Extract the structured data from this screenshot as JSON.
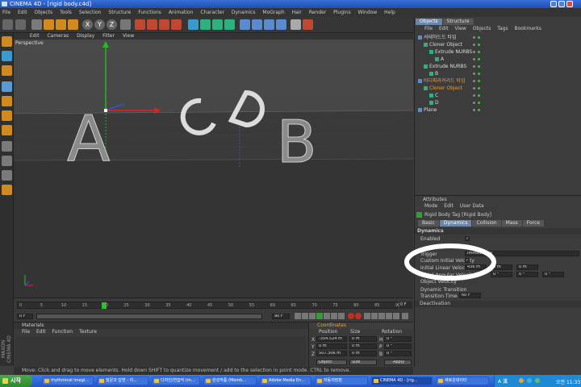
{
  "window": {
    "title": "CINEMA 4D - [rigid body.c4d]"
  },
  "menu": [
    "File",
    "Edit",
    "Objects",
    "Tools",
    "Selection",
    "Structure",
    "Functions",
    "Animation",
    "Character",
    "Dynamics",
    "MoGraph",
    "Hair",
    "Render",
    "Plugins",
    "Window",
    "Help"
  ],
  "toolbar": {
    "axis_labels": [
      "X",
      "Y",
      "Z"
    ]
  },
  "viewport": {
    "menu": [
      "Edit",
      "Cameras",
      "Display",
      "Filter",
      "View"
    ],
    "label": "Perspective",
    "scene_letters": [
      "A",
      "B"
    ]
  },
  "timeline": {
    "ticks": [
      "0",
      "5",
      "10",
      "15",
      "20",
      "25",
      "30",
      "35",
      "40",
      "45",
      "50",
      "55",
      "60",
      "65",
      "70",
      "75",
      "80",
      "85",
      "90"
    ],
    "current_frame": "0 F",
    "end_frame": "90 F",
    "end_field": "0 F",
    "start_field": "0 F"
  },
  "materials": {
    "title": "Materials",
    "menu": [
      "File",
      "Edit",
      "Function",
      "Texture"
    ]
  },
  "coordinates": {
    "title": "Coordinates",
    "headers": [
      "Position",
      "Size",
      "Rotation"
    ],
    "rows": [
      {
        "axis": "X",
        "pos": "-354.524 m",
        "size": "0 m",
        "rot_label": "H",
        "rot": "0 °"
      },
      {
        "axis": "Y",
        "pos": "0 m",
        "size": "0 m",
        "rot_label": "P",
        "rot": "0 °"
      },
      {
        "axis": "Z",
        "pos": "507.306 m",
        "size": "0 m",
        "rot_label": "B",
        "rot": "0 °"
      }
    ],
    "mode": "Object",
    "size_mode": "Size",
    "apply": "Apply"
  },
  "objects": {
    "tabs": [
      "Objects",
      "Structure"
    ],
    "menu": [
      "File",
      "Edit",
      "View",
      "Objects",
      "Tags",
      "Bookmarks"
    ],
    "rows": [
      {
        "label": "서테하드드 타입",
        "indent": 0,
        "color": "#dddddd"
      },
      {
        "label": "Cloner Object",
        "indent": 1,
        "color": "#dddddd"
      },
      {
        "label": "Extrude NURBS",
        "indent": 2,
        "color": "#dddddd"
      },
      {
        "label": "A",
        "indent": 3,
        "color": "#dddddd"
      },
      {
        "label": "Extrude NURBS",
        "indent": 1,
        "color": "#dddddd"
      },
      {
        "label": "B",
        "indent": 2,
        "color": "#dddddd"
      },
      {
        "label": "바디피라커리드 타입",
        "indent": 0,
        "color": "#e8a040"
      },
      {
        "label": "Cloner Object",
        "indent": 1,
        "color": "#e8a040"
      },
      {
        "label": "C",
        "indent": 2,
        "color": "#dddddd"
      },
      {
        "label": "D",
        "indent": 2,
        "color": "#dddddd"
      },
      {
        "label": "Plane",
        "indent": 0,
        "color": "#dddddd"
      }
    ]
  },
  "attributes": {
    "title": "Attributes",
    "menu": [
      "Mode",
      "Edit",
      "User Data"
    ],
    "tag_title": "Rigid Body Tag [Rigid Body]",
    "tabs": [
      "Basic",
      "Dynamics",
      "Collision",
      "Mass",
      "Force"
    ],
    "section": "Dynamics",
    "enabled_label": "Enabled",
    "trigger_label": "Trigger",
    "trigger_value": "Immediately",
    "custom_velocity": "Custom Initial Velocity",
    "linear_velocity_label": "Initial Linear Velocity",
    "linear_velocity": [
      "436 m",
      "0 m",
      "0 m"
    ],
    "angular_velocity_label": "Initial Angular Velocity",
    "angular_velocity": [
      "0 °",
      "0 °",
      "0 °"
    ],
    "object_velocity": "Object Velocity",
    "dyn_transition": "Dynamic Transition",
    "transition_time_label": "Transition Time",
    "transition_time": "60 F",
    "deactivation": "Deactivation"
  },
  "status": {
    "text": "Move: Click and drag to move elements. Hold down SHIFT to quantize movement / add to the selection in point mode. CTRL to remove."
  },
  "side_brand": "MAXON CINEMA 4D",
  "taskbar": {
    "start": "시작",
    "items": [
      "rhythmical imagi...",
      "질문과 답변 - 리...",
      "디자인/연습작 (m...",
      "완성작품 (Memb...",
      "Adobe Media En...",
      "자동저장판",
      "CINEMA 4D - [rig...",
      "새로운데이터"
    ],
    "tray": "A 漢",
    "clock": "오전 11:33"
  },
  "colors": {
    "accent": "#5a7fb4",
    "highlight": "#e8a040",
    "x_axis": "#e02020",
    "y_axis": "#20c020",
    "z_axis": "#3050f0"
  }
}
